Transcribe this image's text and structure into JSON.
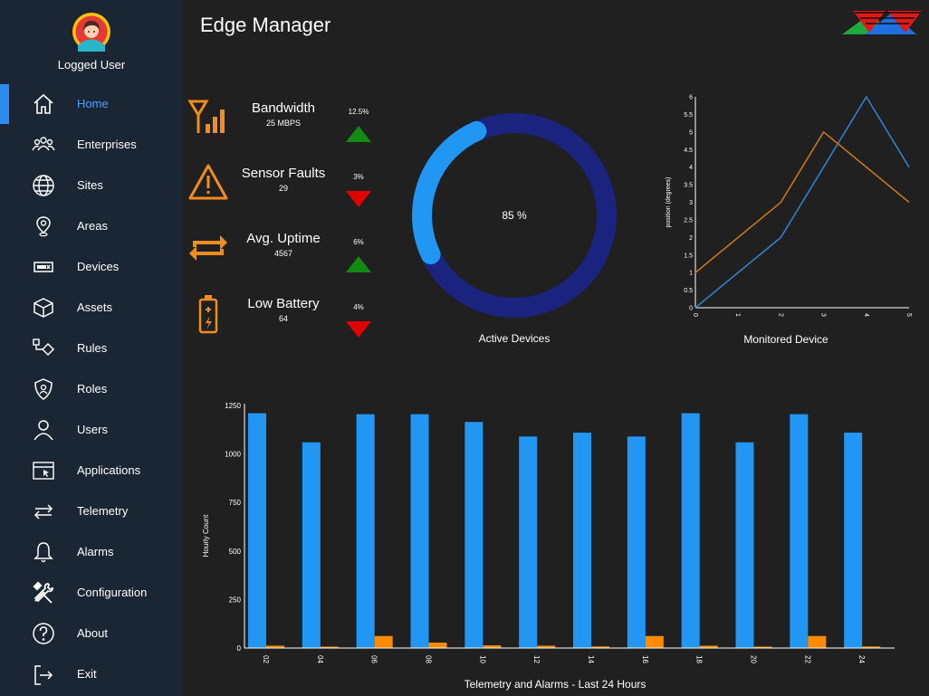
{
  "app": {
    "title": "Edge Manager"
  },
  "user": {
    "label": "Logged User"
  },
  "nav": [
    {
      "id": "home",
      "label": "Home",
      "icon": "home-icon",
      "active": true
    },
    {
      "id": "enterprises",
      "label": "Enterprises",
      "icon": "people-icon"
    },
    {
      "id": "sites",
      "label": "Sites",
      "icon": "globe-icon"
    },
    {
      "id": "areas",
      "label": "Areas",
      "icon": "map-pin-icon"
    },
    {
      "id": "devices",
      "label": "Devices",
      "icon": "device-icon"
    },
    {
      "id": "assets",
      "label": "Assets",
      "icon": "cube-icon"
    },
    {
      "id": "rules",
      "label": "Rules",
      "icon": "flow-icon"
    },
    {
      "id": "roles",
      "label": "Roles",
      "icon": "shield-user-icon"
    },
    {
      "id": "users",
      "label": "Users",
      "icon": "user-icon"
    },
    {
      "id": "applications",
      "label": "Applications",
      "icon": "app-window-icon"
    },
    {
      "id": "telemetry",
      "label": "Telemetry",
      "icon": "exchange-icon"
    },
    {
      "id": "alarms",
      "label": "Alarms",
      "icon": "bell-icon"
    },
    {
      "id": "configuration",
      "label": "Configuration",
      "icon": "tools-icon"
    },
    {
      "id": "about",
      "label": "About",
      "icon": "help-circle-icon"
    },
    {
      "id": "exit",
      "label": "Exit",
      "icon": "exit-icon"
    }
  ],
  "kpis": [
    {
      "id": "bandwidth",
      "title": "Bandwidth",
      "value": "25 MBPS",
      "change": "12.5%",
      "trend": "up",
      "icon": "antenna-signal-icon"
    },
    {
      "id": "sensor-faults",
      "title": "Sensor Faults",
      "value": "29",
      "change": "3%",
      "trend": "down",
      "icon": "warning-icon"
    },
    {
      "id": "avg-uptime",
      "title": "Avg. Uptime",
      "value": "4567",
      "change": "6%",
      "trend": "up",
      "icon": "repeat-icon"
    },
    {
      "id": "low-battery",
      "title": "Low Battery",
      "value": "64",
      "change": "4%",
      "trend": "down",
      "icon": "battery-icon"
    }
  ],
  "colors": {
    "accent": "#2d8cf0",
    "orange": "#ff8c00",
    "up": "#138a13",
    "down": "#e00000",
    "donut_track": "#1a237e",
    "donut_fill": "#2196f3",
    "line_blue": "#2f7fc8",
    "line_orange": "#c8741c",
    "bar_blue": "#2196f3",
    "bar_orange": "#ff8c00"
  },
  "active_devices": {
    "caption": "Active Devices",
    "label": "85 %",
    "percent": 85
  },
  "monitored_device": {
    "caption": "Monitored Device",
    "chart_data": {
      "type": "line",
      "ylabel": "position (degrees)",
      "xlim": [
        0,
        5
      ],
      "ylim": [
        0,
        6
      ],
      "xticks": [
        "0",
        "1",
        "2",
        "3",
        "4",
        "5"
      ],
      "yticks": [
        "0",
        "0.5",
        "1",
        "1.5",
        "2",
        "2.5",
        "3",
        "3.5",
        "4",
        "4.5",
        "5",
        "5.5",
        "6"
      ],
      "series": [
        {
          "color": "#2f7fc8",
          "x": [
            0,
            2,
            4,
            5
          ],
          "y": [
            0,
            2,
            6,
            4
          ]
        },
        {
          "color": "#c8741c",
          "x": [
            0,
            2,
            3,
            5
          ],
          "y": [
            1,
            3,
            5,
            3
          ]
        }
      ]
    }
  },
  "telemetry_alarms": {
    "caption": "Telemetry and Alarms - Last 24 Hours",
    "chart_data": {
      "type": "bar",
      "ylabel": "Hourly Count",
      "ylim": [
        0,
        1250
      ],
      "yticks": [
        "0",
        "250",
        "500",
        "750",
        "1000",
        "1250"
      ],
      "categories": [
        "02",
        "04",
        "06",
        "08",
        "10",
        "12",
        "14",
        "16",
        "18",
        "20",
        "22",
        "24"
      ],
      "series": [
        {
          "color": "#2196f3",
          "values": [
            1210,
            1060,
            1205,
            1205,
            1165,
            1090,
            1110,
            1090,
            1210,
            1060,
            1205,
            1110
          ]
        },
        {
          "color": "#ff8c00",
          "values": [
            12,
            7,
            62,
            28,
            14,
            12,
            8,
            62,
            12,
            7,
            62,
            8
          ]
        }
      ]
    }
  }
}
